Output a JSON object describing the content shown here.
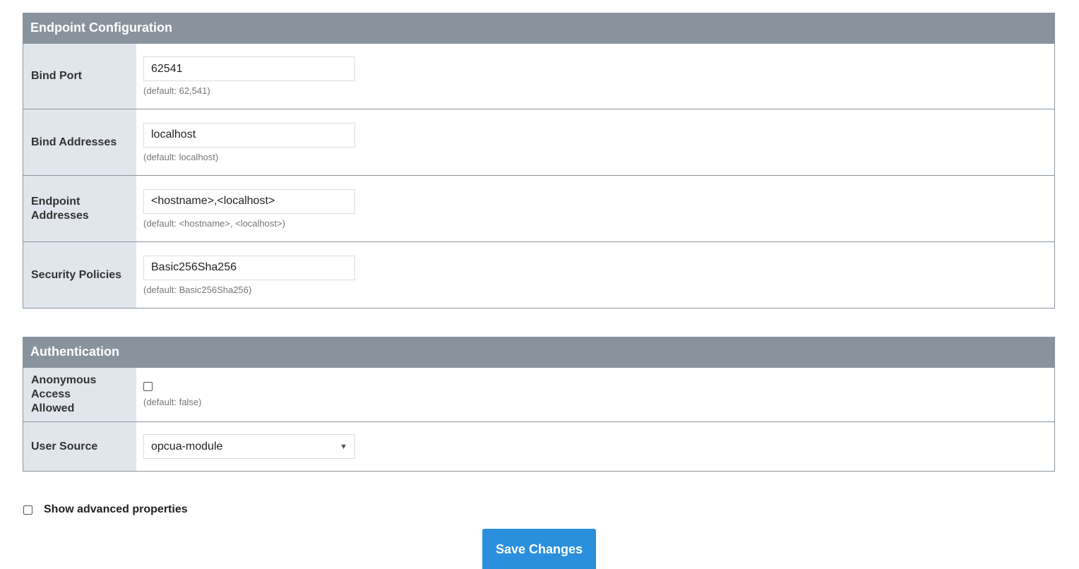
{
  "endpoint": {
    "title": "Endpoint Configuration",
    "rows": [
      {
        "label": "Bind Port",
        "value": "62541",
        "hint": "(default: 62,541)"
      },
      {
        "label": "Bind Addresses",
        "value": "localhost",
        "hint": "(default: localhost)"
      },
      {
        "label": "Endpoint Addresses",
        "value": "<hostname>,<localhost>",
        "hint": "(default: <hostname>, <localhost>)"
      },
      {
        "label": "Security Policies",
        "value": "Basic256Sha256",
        "hint": "(default: Basic256Sha256)"
      }
    ]
  },
  "auth": {
    "title": "Authentication",
    "anonymous": {
      "label": "Anonymous Access Allowed",
      "checked": false,
      "hint": "(default: false)"
    },
    "user_source": {
      "label": "User Source",
      "value": "opcua-module"
    }
  },
  "advanced": {
    "label": "Show advanced properties",
    "checked": false
  },
  "save_label": "Save Changes"
}
